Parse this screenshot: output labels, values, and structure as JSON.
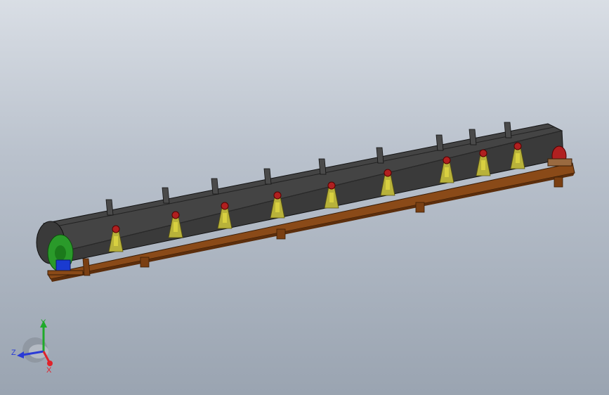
{
  "triad": {
    "x_label": "X",
    "y_label": "Y",
    "z_label": "Z",
    "x_color": "#e0222a",
    "y_color": "#1faa2a",
    "z_color": "#2a3bd6"
  },
  "colors": {
    "belt": "#3f3f3f",
    "frame": "#8a4a18",
    "idler": "#d8d040",
    "drive_pulley": "#2a9a2a",
    "motor": "#1a3ad0",
    "tail_pulley": "#b02020"
  }
}
